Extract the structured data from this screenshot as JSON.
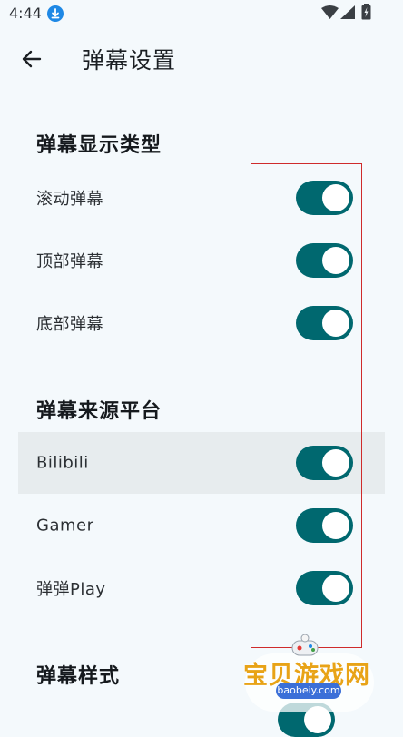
{
  "status_bar": {
    "time": "4:44",
    "icons": [
      "download-icon",
      "wifi-icon",
      "signal-icon",
      "battery-icon"
    ]
  },
  "app_bar": {
    "back_icon": "arrow-left-icon",
    "title": "弹幕设置"
  },
  "sections": [
    {
      "header": "弹幕显示类型",
      "items": [
        {
          "label": "滚动弹幕",
          "enabled": true
        },
        {
          "label": "顶部弹幕",
          "enabled": true
        },
        {
          "label": "底部弹幕",
          "enabled": true
        }
      ]
    },
    {
      "header": "弹幕来源平台",
      "items": [
        {
          "label": "Bilibili",
          "enabled": true
        },
        {
          "label": "Gamer",
          "enabled": true
        },
        {
          "label": "弹弹Play",
          "enabled": true
        }
      ]
    },
    {
      "header": "弹幕样式",
      "items": []
    }
  ],
  "watermark": {
    "text": "宝贝游戏网",
    "sub": "baobeiy.com"
  },
  "colors": {
    "background": "#f4f9fc",
    "switch_on": "#00686f",
    "highlight_row": "#e7ecee",
    "annotation_box": "#cf2b2b"
  }
}
